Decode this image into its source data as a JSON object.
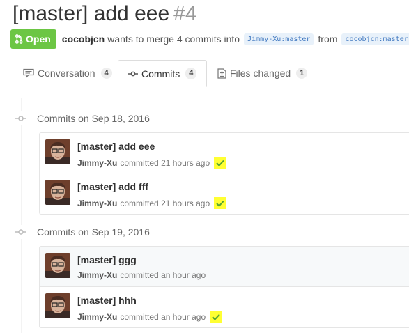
{
  "pr": {
    "title": "[master] add eee",
    "number": "#4",
    "state": "Open",
    "author": "cocobjcn",
    "text_merge": "wants to merge 4 commits into",
    "base_branch": "Jimmy-Xu:master",
    "text_from": "from",
    "head_branch": "cocobjcn:master"
  },
  "tabs": [
    {
      "label": "Conversation",
      "count": "4",
      "icon": "comment-icon"
    },
    {
      "label": "Commits",
      "count": "4",
      "icon": "commit-icon"
    },
    {
      "label": "Files changed",
      "count": "1",
      "icon": "file-diff-icon"
    }
  ],
  "groups": [
    {
      "heading": "Commits on Sep 18, 2016",
      "commits": [
        {
          "message": "[master] add eee",
          "author": "Jimmy-Xu",
          "action": "committed",
          "time": "21 hours ago",
          "status": "check"
        },
        {
          "message": "[master] add fff",
          "author": "Jimmy-Xu",
          "action": "committed",
          "time": "21 hours ago",
          "status": "check"
        }
      ]
    },
    {
      "heading": "Commits on Sep 19, 2016",
      "commits": [
        {
          "message": "[master] ggg",
          "author": "Jimmy-Xu",
          "action": "committed",
          "time": "an hour ago",
          "status": ""
        },
        {
          "message": "[master] hhh",
          "author": "Jimmy-Xu",
          "action": "committed",
          "time": "an hour ago",
          "status": "check"
        }
      ]
    }
  ],
  "colors": {
    "open_green": "#6cc644",
    "check_highlight": "#ffff33",
    "check_green": "#55a532",
    "branch_blue": "#4078c0"
  }
}
